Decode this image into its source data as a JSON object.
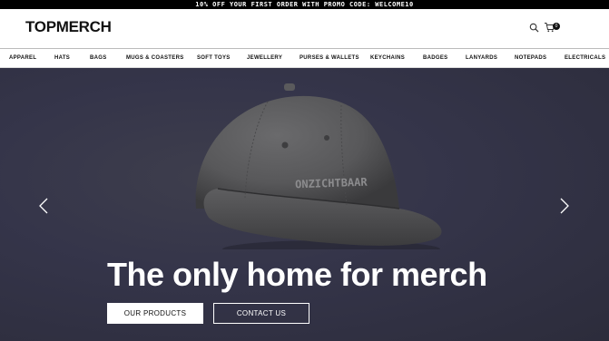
{
  "promo": {
    "text": "10% OFF YOUR FIRST ORDER WITH PROMO CODE: WELCOME10"
  },
  "header": {
    "logo": "TOPMERCH",
    "search_icon": "search-icon",
    "cart_icon": "cart-icon",
    "cart_count": "0"
  },
  "nav": {
    "items": [
      {
        "label": "APPAREL"
      },
      {
        "label": "HATS"
      },
      {
        "label": "BAGS"
      },
      {
        "label": "MUGS & COASTERS"
      },
      {
        "label": "SOFT TOYS"
      },
      {
        "label": "JEWELLERY"
      },
      {
        "label": "PURSES & WALLETS"
      },
      {
        "label": "KEYCHAINS"
      },
      {
        "label": "BADGES"
      },
      {
        "label": "LANYARDS"
      },
      {
        "label": "NOTEPADS"
      },
      {
        "label": "ELECTRICALS"
      }
    ]
  },
  "hero": {
    "cap_print": "ONZICHTBAAR",
    "headline": "The only home for merch",
    "primary_button": "OUR PRODUCTS",
    "secondary_button": "CONTACT US",
    "prev_icon": "chevron-left-icon",
    "next_icon": "chevron-right-icon"
  },
  "colors": {
    "promo_bg": "#000000",
    "hero_bg": "#35354a",
    "cap": "#5a5a5c"
  }
}
